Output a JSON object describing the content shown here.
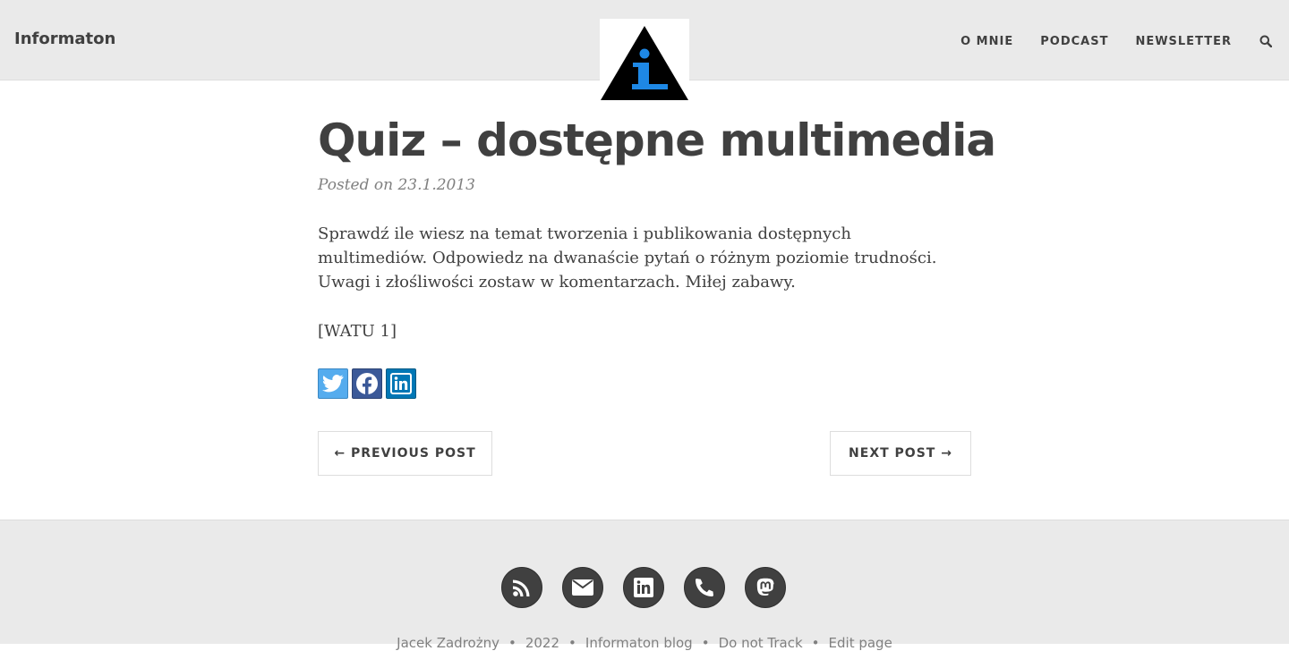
{
  "navbar": {
    "brand": "Informaton",
    "links": [
      {
        "label": "O MNIE"
      },
      {
        "label": "PODCAST"
      },
      {
        "label": "NEWSLETTER"
      }
    ],
    "search_icon": "search-icon"
  },
  "logo": {
    "icon": "triangle-info-logo",
    "letter": "i"
  },
  "article": {
    "title": "Quiz – dostępne multimedia",
    "meta": "Posted on 23.1.2013",
    "body": "Sprawdź ile wiesz na temat tworzenia i publikowania dostępnych multimediów. Odpowiedz na dwanaście pytań o różnym poziomie trudności. Uwagi i złośliwości zostaw w komentarzach. Miłej zabawy.",
    "shortcode": "[WATU 1]",
    "share": [
      {
        "network": "twitter",
        "icon": "twitter-icon",
        "color": "#55acee"
      },
      {
        "network": "facebook",
        "icon": "facebook-icon",
        "color": "#3b5998"
      },
      {
        "network": "linkedin",
        "icon": "linkedin-icon",
        "color": "#0077b5"
      }
    ]
  },
  "pager": {
    "previous": "← PREVIOUS POST",
    "next": "NEXT POST →"
  },
  "footer": {
    "social": [
      {
        "icon": "rss-icon"
      },
      {
        "icon": "email-icon"
      },
      {
        "icon": "linkedin-icon"
      },
      {
        "icon": "phone-icon"
      },
      {
        "icon": "mastodon-icon"
      }
    ],
    "copyright": [
      "Jacek Zadrożny",
      "2022",
      "Informaton blog",
      "Do not Track",
      "Edit page"
    ],
    "separator": "•"
  },
  "colors": {
    "navbar_bg": "#eaeaea",
    "text": "#404040",
    "muted": "#808080",
    "logo_blue": "#1e88e5"
  }
}
